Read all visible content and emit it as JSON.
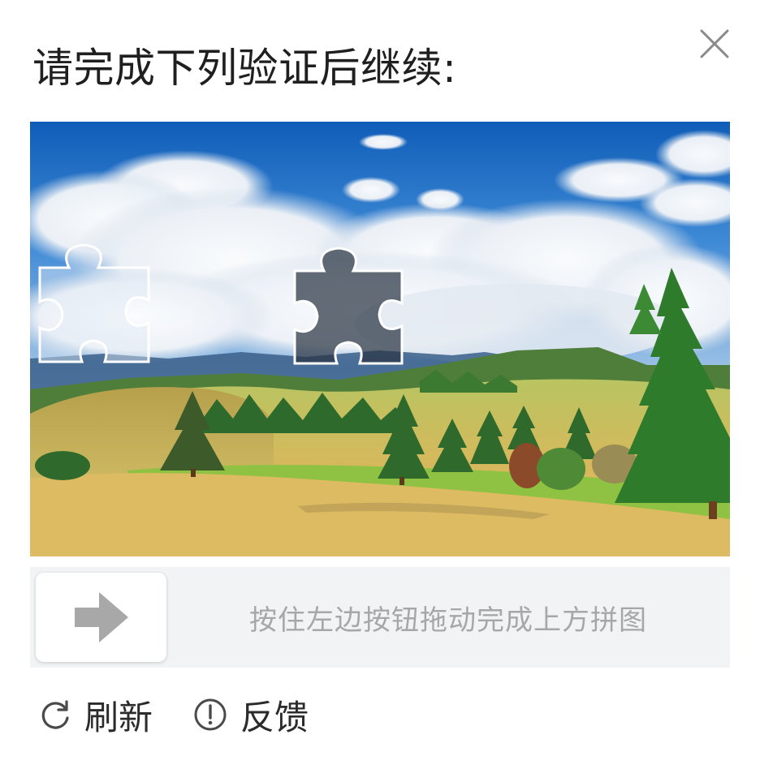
{
  "dialog": {
    "title": "请完成下列验证后继续:",
    "close_icon": "close-icon"
  },
  "captcha": {
    "image_description": "",
    "slider_hint": "按住左边按钮拖动完成上方拼图",
    "handle_icon": "arrow-right-icon"
  },
  "footer": {
    "refresh_label": "刷新",
    "refresh_icon": "refresh-icon",
    "feedback_label": "反馈",
    "feedback_icon": "exclamation-circle-icon"
  },
  "colors": {
    "sky": "#1f6fc0",
    "grass": "#8dbb3a",
    "field": "#d9b65a",
    "tree": "#2f6e2a",
    "track": "#f2f3f5",
    "hint_text": "#a7a7a7"
  }
}
